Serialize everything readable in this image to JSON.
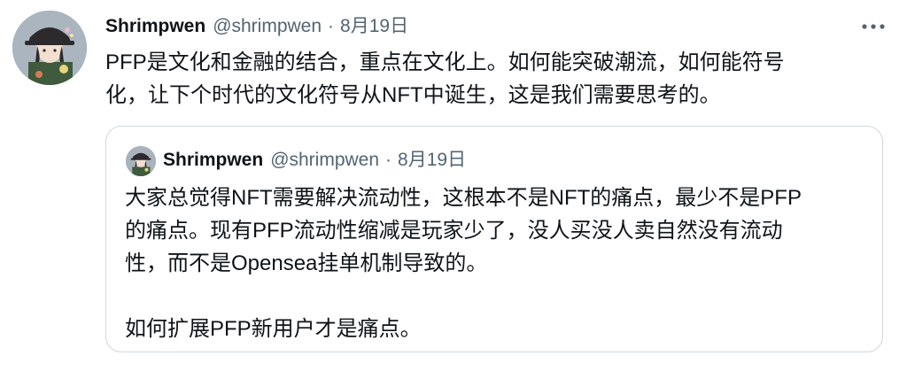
{
  "tweet": {
    "author": {
      "name": "Shrimpwen",
      "handle": "@shrimpwen",
      "separator": "·",
      "date": "8月19日"
    },
    "more_icon": "more-dots-icon",
    "text_lines": [
      "PFP是文化和金融的结合，重点在文化上。如何能突破潮流，如何能符号",
      "化，让下个时代的文化符号从NFT中诞生，这是我们需要思考的。"
    ],
    "quoted": {
      "author": {
        "name": "Shrimpwen",
        "handle": "@shrimpwen",
        "separator": "·",
        "date": "8月19日"
      },
      "text_lines": [
        "大家总觉得NFT需要解决流动性，这根本不是NFT的痛点，最少不是PFP",
        "的痛点。现有PFP流动性缩减是玩家少了，没人买没人卖自然没有流动",
        "性，而不是Opensea挂单机制导致的。",
        "",
        "如何扩展PFP新用户才是痛点。"
      ]
    }
  },
  "colors": {
    "text_primary": "#0f1419",
    "text_secondary": "#536471",
    "border": "#cfd9de"
  }
}
